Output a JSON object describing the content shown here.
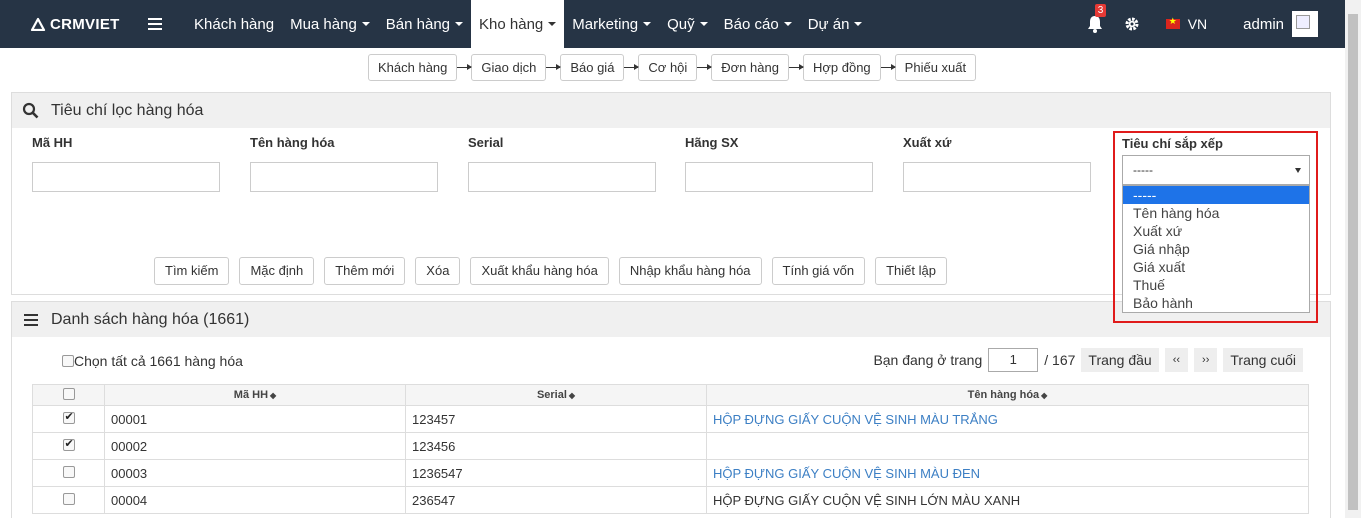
{
  "navbar": {
    "logo": "CRMVIET",
    "menu": [
      {
        "label": "Khách hàng",
        "dropdown": false
      },
      {
        "label": "Mua hàng",
        "dropdown": true
      },
      {
        "label": "Bán hàng",
        "dropdown": true
      },
      {
        "label": "Kho hàng",
        "dropdown": true,
        "active": true
      },
      {
        "label": "Marketing",
        "dropdown": true
      },
      {
        "label": "Quỹ",
        "dropdown": true
      },
      {
        "label": "Báo cáo",
        "dropdown": true
      },
      {
        "label": "Dự án",
        "dropdown": true
      }
    ],
    "notification_count": "3",
    "language": "VN",
    "user": "admin"
  },
  "flow": [
    "Khách hàng",
    "Giao dịch",
    "Báo giá",
    "Cơ hội",
    "Đơn hàng",
    "Hợp đồng",
    "Phiếu xuất"
  ],
  "filter_panel": {
    "title": "Tiêu chí lọc hàng hóa",
    "fields": {
      "code": {
        "label": "Mã HH",
        "value": ""
      },
      "name": {
        "label": "Tên hàng hóa",
        "value": ""
      },
      "serial": {
        "label": "Serial",
        "value": ""
      },
      "maker": {
        "label": "Hãng SX",
        "value": ""
      },
      "origin": {
        "label": "Xuất xứ",
        "value": ""
      }
    },
    "sort": {
      "label": "Tiêu chí sắp xếp",
      "selected": "-----",
      "options": [
        "-----",
        "Tên hàng hóa",
        "Xuất xứ",
        "Giá nhập",
        "Giá xuất",
        "Thuế",
        "Bảo hành"
      ]
    },
    "buttons": {
      "search": "Tìm kiếm",
      "default": "Mặc định",
      "add": "Thêm mới",
      "delete": "Xóa",
      "export": "Xuất khẩu hàng hóa",
      "import": "Nhập khẩu hàng hóa",
      "cost": "Tính giá vốn",
      "setup": "Thiết lập"
    }
  },
  "list_panel": {
    "title": "Danh sách hàng hóa (1661)",
    "select_all": "Chọn tất cả 1661 hàng hóa",
    "pager": {
      "prefix": "Bạn đang ở trang",
      "current": "1",
      "total": "/ 167",
      "first": "Trang đầu",
      "prev": "‹‹",
      "next": "››",
      "last": "Trang cuối"
    },
    "columns": {
      "code": "Mã HH",
      "serial": "Serial",
      "name": "Tên hàng hóa"
    },
    "rows": [
      {
        "checked": true,
        "code": "00001",
        "serial": "123457",
        "name": "HỘP ĐỰNG GIẤY CUỘN VỆ SINH MÀU TRẮNG",
        "link": true
      },
      {
        "checked": true,
        "code": "00002",
        "serial": "123456",
        "name": "",
        "link": false
      },
      {
        "checked": false,
        "code": "00003",
        "serial": "1236547",
        "name": "HỘP ĐỰNG GIẤY CUỘN VỆ SINH MÀU ĐEN",
        "link": true
      },
      {
        "checked": false,
        "code": "00004",
        "serial": "236547",
        "name": "HỘP ĐỰNG GIẤY CUỘN VỆ SINH LỚN MÀU XANH",
        "link": false
      }
    ]
  }
}
